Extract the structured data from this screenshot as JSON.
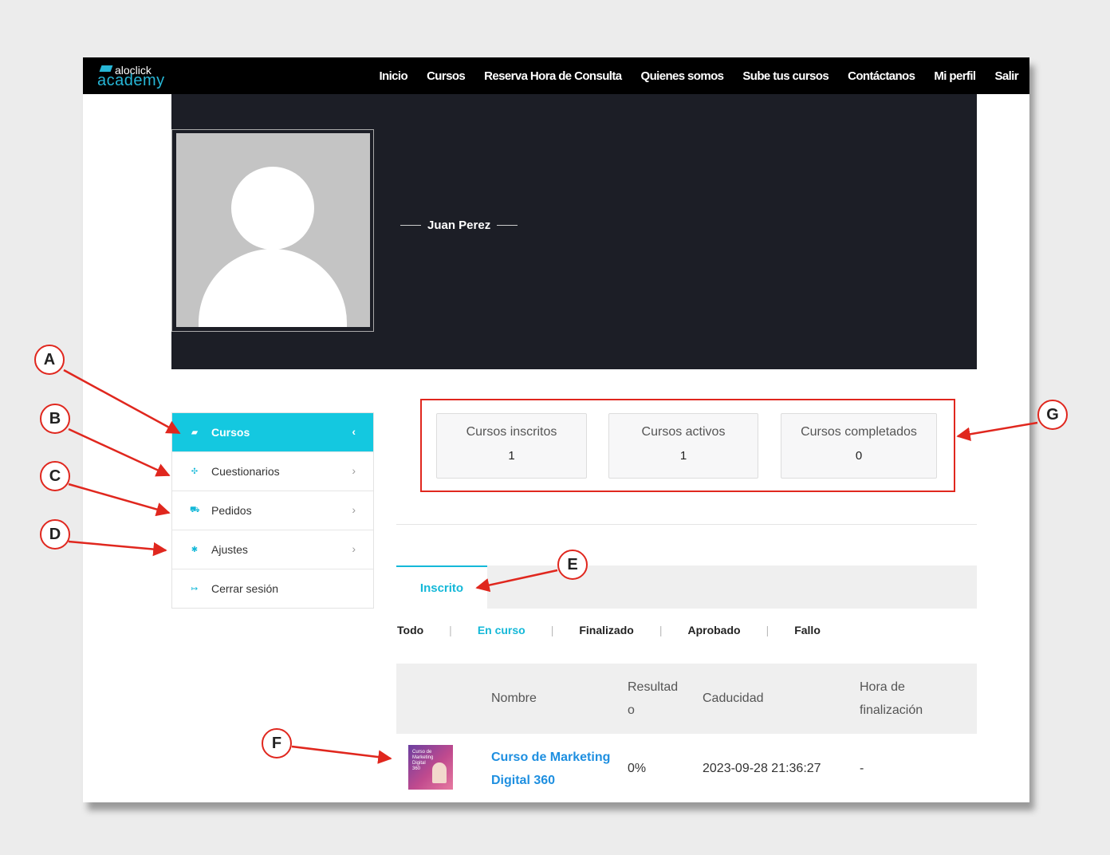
{
  "logo": {
    "top": "aloclick",
    "bottom": "academy"
  },
  "nav": [
    "Inicio",
    "Cursos",
    "Reserva Hora de Consulta",
    "Quienes somos",
    "Sube tus cursos",
    "Contáctanos",
    "Mi perfil",
    "Salir"
  ],
  "profile": {
    "name": "Juan Perez"
  },
  "menu": [
    {
      "label": "Cursos",
      "icon": "book-icon",
      "glyph": "▰",
      "active": true,
      "chevron": "‹"
    },
    {
      "label": "Cuestionarios",
      "icon": "puzzle-icon",
      "glyph": "✣",
      "active": false,
      "chevron": "›"
    },
    {
      "label": "Pedidos",
      "icon": "cart-icon",
      "glyph": "⛟",
      "active": false,
      "chevron": "›"
    },
    {
      "label": "Ajustes",
      "icon": "gear-icon",
      "glyph": "✱",
      "active": false,
      "chevron": "›"
    },
    {
      "label": "Cerrar sesión",
      "icon": "logout-icon",
      "glyph": "↦",
      "active": false,
      "chevron": ""
    }
  ],
  "stats": [
    {
      "label": "Cursos inscritos",
      "value": "1"
    },
    {
      "label": "Cursos activos",
      "value": "1"
    },
    {
      "label": "Cursos completados",
      "value": "0"
    }
  ],
  "tabs": {
    "active": "Inscrito"
  },
  "filters": [
    "Todo",
    "En curso",
    "Finalizado",
    "Aprobado",
    "Fallo"
  ],
  "filters_active": "En curso",
  "table": {
    "headers": {
      "nombre": "Nombre",
      "resultado_1": "Resultad",
      "resultado_2": "o",
      "caducidad": "Caducidad",
      "hora_1": "Hora de",
      "hora_2": "finalización"
    },
    "rows": [
      {
        "thumb_text": "Curso de Marketing Digital 360",
        "name_1": "Curso de Marketing",
        "name_2": "Digital 360",
        "result": "0%",
        "expires": "2023-09-28 21:36:27",
        "finished": "-"
      }
    ]
  },
  "annotations": [
    "A",
    "B",
    "C",
    "D",
    "E",
    "F",
    "G"
  ],
  "colors": {
    "accent": "#14c8e0",
    "annotation": "#e0271e",
    "topbar": "#000000",
    "hero": "#1c1e26"
  }
}
